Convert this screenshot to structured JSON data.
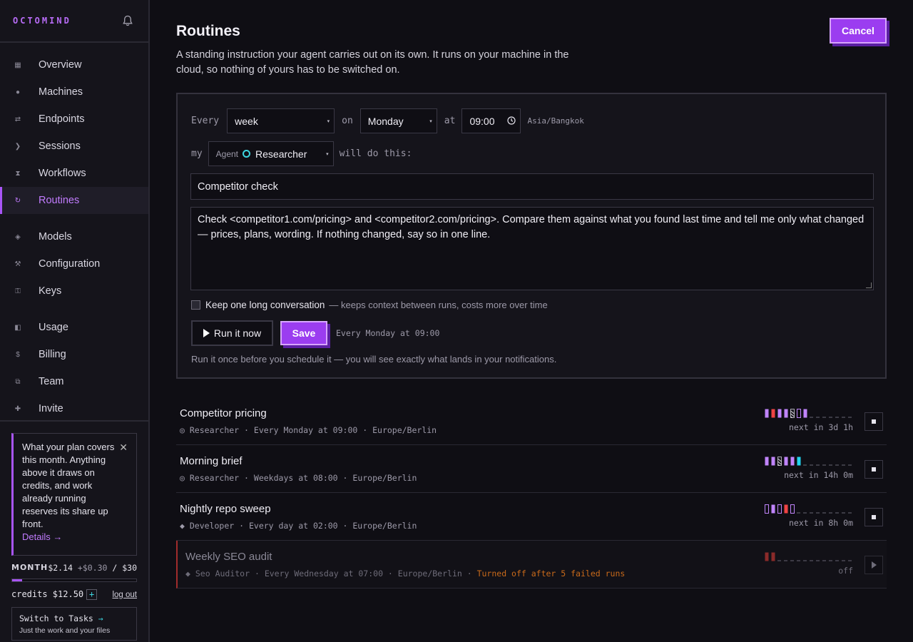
{
  "brand": {
    "logo": "OCTOMIND"
  },
  "sidebar": {
    "groups": [
      [
        {
          "label": "Overview",
          "icon": "grid-icon",
          "glyph": "▦"
        },
        {
          "label": "Machines",
          "icon": "dot-icon",
          "glyph": "●"
        },
        {
          "label": "Endpoints",
          "icon": "arrows-icon",
          "glyph": "⇄"
        },
        {
          "label": "Sessions",
          "icon": "chevron-right-icon",
          "glyph": "❯"
        },
        {
          "label": "Workflows",
          "icon": "hourglass-icon",
          "glyph": "⧗"
        },
        {
          "label": "Routines",
          "icon": "refresh-icon",
          "glyph": "↻",
          "active": true
        }
      ],
      [
        {
          "label": "Models",
          "icon": "diamond-icon",
          "glyph": "◈"
        },
        {
          "label": "Configuration",
          "icon": "tools-icon",
          "glyph": "⚒"
        },
        {
          "label": "Keys",
          "icon": "key-icon",
          "glyph": "⚿"
        }
      ],
      [
        {
          "label": "Usage",
          "icon": "half-square-icon",
          "glyph": "◧"
        },
        {
          "label": "Billing",
          "icon": "dollar-icon",
          "glyph": "$"
        },
        {
          "label": "Team",
          "icon": "team-icon",
          "glyph": "⧉"
        },
        {
          "label": "Invite",
          "icon": "plus-icon",
          "glyph": "✚"
        }
      ]
    ]
  },
  "plan": {
    "text": "What your plan covers this month. Anything above it draws on credits, and work already running reserves its share up front.",
    "details": "Details →",
    "month_label": "MONTH",
    "month_used": "$2.14",
    "month_reserved": "+$0.30",
    "month_total": "/ $30",
    "usage_fraction": 0.08,
    "credits": "credits $12.50",
    "credits_add": "+",
    "logout": "log out",
    "switch_title": "Switch to Tasks",
    "switch_arrow": "→",
    "switch_sub": "Just the work and your files"
  },
  "header": {
    "title": "Routines",
    "description": "A standing instruction your agent carries out on its own. It runs on your machine in the cloud, so nothing of yours has to be switched on.",
    "cancel": "Cancel"
  },
  "editor": {
    "every_label": "Every",
    "frequency": "week",
    "on_label": "on",
    "day": "Monday",
    "at_label": "at",
    "time": "09:00",
    "timezone": "Asia/Bangkok",
    "my_label": "my",
    "agent_tag": "Agent",
    "agent_name": "Researcher",
    "will_label": "will do this:",
    "title": "Competitor check",
    "body": "Check <competitor1.com/pricing> and <competitor2.com/pricing>. Compare them against what you found last time and tell me only what changed — prices, plans, wording. If nothing changed, say so in one line.",
    "keep_label": "Keep one long conversation",
    "keep_hint": "— keeps context between runs, costs more over time",
    "keep_checked": false,
    "run_now": "Run it now",
    "save": "Save",
    "schedule_preview": "Every Monday at 09:00",
    "hint": "Run it once before you schedule it — you will see exactly what lands in your notifications."
  },
  "routines": [
    {
      "name": "Competitor pricing",
      "agent_icon": "◎",
      "agent": "Researcher",
      "schedule": "Every Monday at 09:00",
      "tz": "Europe/Berlin",
      "next": "next in 3d 1h",
      "runs": [
        "ok",
        "fail",
        "ok",
        "ok",
        "partial",
        "empty",
        "ok"
      ],
      "enabled": true
    },
    {
      "name": "Morning brief",
      "agent_icon": "◎",
      "agent": "Researcher",
      "schedule": "Weekdays at 08:00",
      "tz": "Europe/Berlin",
      "next": "next in 14h 0m",
      "runs": [
        "ok",
        "ok",
        "partial",
        "ok",
        "ok",
        "cyan"
      ],
      "enabled": true
    },
    {
      "name": "Nightly repo sweep",
      "agent_icon": "◆",
      "agent": "Developer",
      "schedule": "Every day at 02:00",
      "tz": "Europe/Berlin",
      "next": "next in 8h 0m",
      "runs": [
        "empty",
        "ok",
        "empty",
        "fail",
        "empty"
      ],
      "enabled": true
    },
    {
      "name": "Weekly SEO audit",
      "agent_icon": "◆",
      "agent": "Seo Auditor",
      "schedule": "Every Wednesday at 07:00",
      "tz": "Europe/Berlin",
      "warning": "Turned off after 5 failed runs",
      "next": "off",
      "runs": [
        "dimfail",
        "dimfail"
      ],
      "enabled": false
    }
  ],
  "colors": {
    "accent": "#a855f7",
    "ok": "#c084fc",
    "fail": "#ef4444",
    "cyan": "#22d3ee",
    "warn": "#c96a1a"
  }
}
